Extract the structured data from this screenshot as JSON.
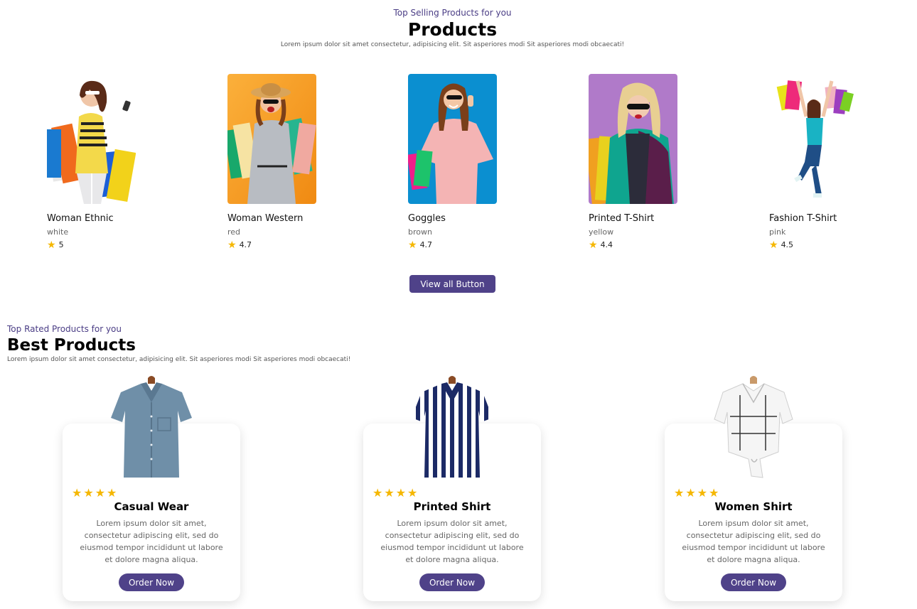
{
  "top_selling": {
    "eyebrow": "Top Selling Products for you",
    "title": "Products",
    "description": "Lorem ipsum dolor sit amet consectetur, adipisicing elit. Sit asperiores modi Sit asperiores modi obcaecati!",
    "products": [
      {
        "name": "Woman Ethnic",
        "color": "white",
        "rating": "5"
      },
      {
        "name": "Woman Western",
        "color": "red",
        "rating": "4.7"
      },
      {
        "name": "Goggles",
        "color": "brown",
        "rating": "4.7"
      },
      {
        "name": "Printed T-Shirt",
        "color": "yellow",
        "rating": "4.4"
      },
      {
        "name": "Fashion T-Shirt",
        "color": "pink",
        "rating": "4.5"
      }
    ],
    "view_all_label": "View all Button"
  },
  "top_rated": {
    "eyebrow": "Top Rated Products for you",
    "title": "Best Products",
    "description": "Lorem ipsum dolor sit amet consectetur, adipisicing elit. Sit asperiores modi Sit asperiores modi obcaecati!",
    "cards": [
      {
        "title": "Casual Wear",
        "stars": 4,
        "description": "Lorem ipsum dolor sit amet, consectetur adipiscing elit, sed do eiusmod tempor incididunt ut labore et dolore magna aliqua.",
        "button": "Order Now"
      },
      {
        "title": "Printed Shirt",
        "stars": 4,
        "description": "Lorem ipsum dolor sit amet, consectetur adipiscing elit, sed do eiusmod tempor incididunt ut labore et dolore magna aliqua.",
        "button": "Order Now"
      },
      {
        "title": "Women Shirt",
        "stars": 4,
        "description": "Lorem ipsum dolor sit amet, consectetur adipiscing elit, sed do eiusmod tempor incididunt ut labore et dolore magna aliqua.",
        "button": "Order Now"
      }
    ]
  },
  "colors": {
    "accent": "#4f4289",
    "star": "#f5b700",
    "eyebrow": "#4a3d85"
  },
  "icons": {
    "star": "star-icon"
  }
}
